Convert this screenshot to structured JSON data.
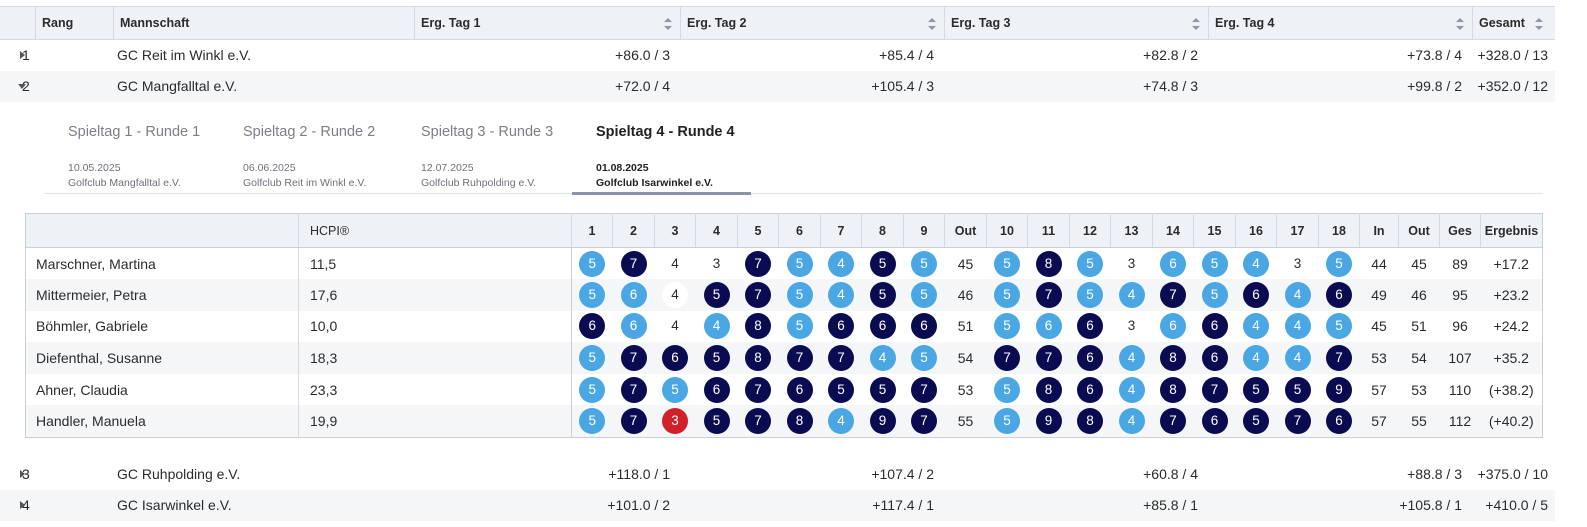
{
  "team_table": {
    "headers": [
      "Rang",
      "Mannschaft",
      "Erg. Tag 1",
      "Erg. Tag 2",
      "Erg. Tag 3",
      "Erg. Tag 4",
      "Gesamt"
    ],
    "rows": [
      {
        "rank": "1",
        "team": "GC Reit im Winkl e.V.",
        "day1": "+86.0 / 3",
        "day2": "+85.4 / 4",
        "day3": "+82.8 / 2",
        "day4": "+73.8 / 4",
        "total": "+328.0 / 13",
        "expanded": false
      },
      {
        "rank": "2",
        "team": "GC Mangfalltal e.V.",
        "day1": "+72.0 / 4",
        "day2": "+105.4 / 3",
        "day3": "+74.8 / 3",
        "day4": "+99.8 / 2",
        "total": "+352.0 / 12",
        "expanded": true
      },
      {
        "rank": "3",
        "team": "GC Ruhpolding e.V.",
        "day1": "+118.0 / 1",
        "day2": "+107.4 / 2",
        "day3": "+60.8 / 4",
        "day4": "+88.8 / 3",
        "total": "+375.0 / 10",
        "expanded": false
      },
      {
        "rank": "4",
        "team": "GC Isarwinkel e.V.",
        "day1": "+101.0 / 2",
        "day2": "+117.4 / 1",
        "day3": "+85.8 / 1",
        "day4": "+105.8 / 1",
        "total": "+410.0 / 5",
        "expanded": false
      }
    ]
  },
  "round_tabs": [
    {
      "title": "Spieltag 1 - Runde 1",
      "date": "10.05.2025",
      "club": "Golfclub Mangfalltal e.V.",
      "active": false
    },
    {
      "title": "Spieltag 2 - Runde 2",
      "date": "06.06.2025",
      "club": "Golfclub Reit im Winkl e.V.",
      "active": false
    },
    {
      "title": "Spieltag 3 - Runde 3",
      "date": "12.07.2025",
      "club": "Golfclub Ruhpolding e.V.",
      "active": false
    },
    {
      "title": "Spieltag 4 - Runde 4",
      "date": "01.08.2025",
      "club": "Golfclub Isarwinkel e.V.",
      "active": true
    }
  ],
  "score_table": {
    "headers": {
      "name": "",
      "hcp": "HCPI®",
      "holes": [
        "1",
        "2",
        "3",
        "4",
        "5",
        "6",
        "7",
        "8",
        "9",
        "Out",
        "10",
        "11",
        "12",
        "13",
        "14",
        "15",
        "16",
        "17",
        "18",
        "In",
        "Out",
        "Ges",
        "Ergebnis"
      ]
    },
    "rows": [
      {
        "name": "Marschner, Martina",
        "hcp": "11,5",
        "front": [
          5,
          7,
          4,
          3,
          7,
          5,
          4,
          5,
          5
        ],
        "front_types": [
          "birdie",
          "bogey",
          "par",
          "par",
          "bogey",
          "birdie",
          "birdie",
          "bogey",
          "birdie"
        ],
        "out": "45",
        "back": [
          5,
          8,
          5,
          3,
          6,
          5,
          4,
          3,
          5
        ],
        "back_types": [
          "birdie",
          "bogey",
          "birdie",
          "par",
          "birdie",
          "birdie",
          "birdie",
          "par",
          "birdie"
        ],
        "in": "44",
        "out2": "45",
        "ges": "89",
        "result": "+17.2"
      },
      {
        "name": "Mittermeier, Petra",
        "hcp": "17,6",
        "front": [
          5,
          6,
          4,
          5,
          7,
          5,
          4,
          5,
          5
        ],
        "front_types": [
          "birdie",
          "birdie",
          "par-w",
          "bogey",
          "bogey",
          "birdie",
          "birdie",
          "bogey",
          "birdie"
        ],
        "out": "46",
        "back": [
          5,
          7,
          5,
          4,
          7,
          5,
          6,
          4,
          6
        ],
        "back_types": [
          "birdie",
          "bogey",
          "birdie",
          "birdie",
          "bogey",
          "birdie",
          "bogey",
          "birdie",
          "bogey"
        ],
        "in": "49",
        "out2": "46",
        "ges": "95",
        "result": "+23.2"
      },
      {
        "name": "Böhmler, Gabriele",
        "hcp": "10,0",
        "front": [
          6,
          6,
          4,
          4,
          8,
          5,
          6,
          6,
          6
        ],
        "front_types": [
          "bogey",
          "birdie",
          "par",
          "birdie",
          "bogey",
          "birdie",
          "bogey",
          "bogey",
          "bogey"
        ],
        "out": "51",
        "back": [
          5,
          6,
          6,
          3,
          6,
          6,
          4,
          4,
          5
        ],
        "back_types": [
          "birdie",
          "birdie",
          "bogey",
          "par",
          "birdie",
          "bogey",
          "birdie",
          "birdie",
          "birdie"
        ],
        "in": "45",
        "out2": "51",
        "ges": "96",
        "result": "+24.2"
      },
      {
        "name": "Diefenthal, Susanne",
        "hcp": "18,3",
        "front": [
          5,
          7,
          6,
          5,
          8,
          7,
          7,
          4,
          5
        ],
        "front_types": [
          "birdie",
          "bogey",
          "bogey",
          "bogey",
          "bogey",
          "bogey",
          "bogey",
          "birdie",
          "birdie"
        ],
        "out": "54",
        "back": [
          7,
          7,
          6,
          4,
          8,
          6,
          4,
          4,
          7
        ],
        "back_types": [
          "bogey",
          "bogey",
          "bogey",
          "birdie",
          "bogey",
          "bogey",
          "birdie",
          "birdie",
          "bogey"
        ],
        "in": "53",
        "out2": "54",
        "ges": "107",
        "result": "+35.2"
      },
      {
        "name": "Ahner, Claudia",
        "hcp": "23,3",
        "front": [
          5,
          7,
          5,
          6,
          7,
          6,
          5,
          5,
          7
        ],
        "front_types": [
          "birdie",
          "bogey",
          "birdie",
          "bogey",
          "bogey",
          "bogey",
          "bogey",
          "bogey",
          "bogey"
        ],
        "out": "53",
        "back": [
          5,
          8,
          6,
          4,
          8,
          7,
          5,
          5,
          9
        ],
        "back_types": [
          "birdie",
          "bogey",
          "bogey",
          "birdie",
          "bogey",
          "bogey",
          "bogey",
          "bogey",
          "bogey"
        ],
        "in": "57",
        "out2": "53",
        "ges": "110",
        "result": "(+38.2)"
      },
      {
        "name": "Handler, Manuela",
        "hcp": "19,9",
        "front": [
          5,
          7,
          3,
          5,
          7,
          8,
          4,
          9,
          7
        ],
        "front_types": [
          "birdie",
          "bogey",
          "eagle",
          "bogey",
          "bogey",
          "bogey",
          "birdie",
          "bogey",
          "bogey"
        ],
        "out": "55",
        "back": [
          5,
          9,
          8,
          4,
          7,
          6,
          5,
          7,
          6
        ],
        "back_types": [
          "birdie",
          "bogey",
          "bogey",
          "birdie",
          "bogey",
          "bogey",
          "bogey",
          "bogey",
          "bogey"
        ],
        "in": "57",
        "out2": "55",
        "ges": "112",
        "result": "(+40.2)"
      }
    ]
  },
  "colors": {
    "birdie": "#4aa7e3",
    "bogey": "#0b0b52",
    "eagle": "#d1202a",
    "header_bg": "#eef1f6",
    "row_alt": "#f5f6f8"
  }
}
